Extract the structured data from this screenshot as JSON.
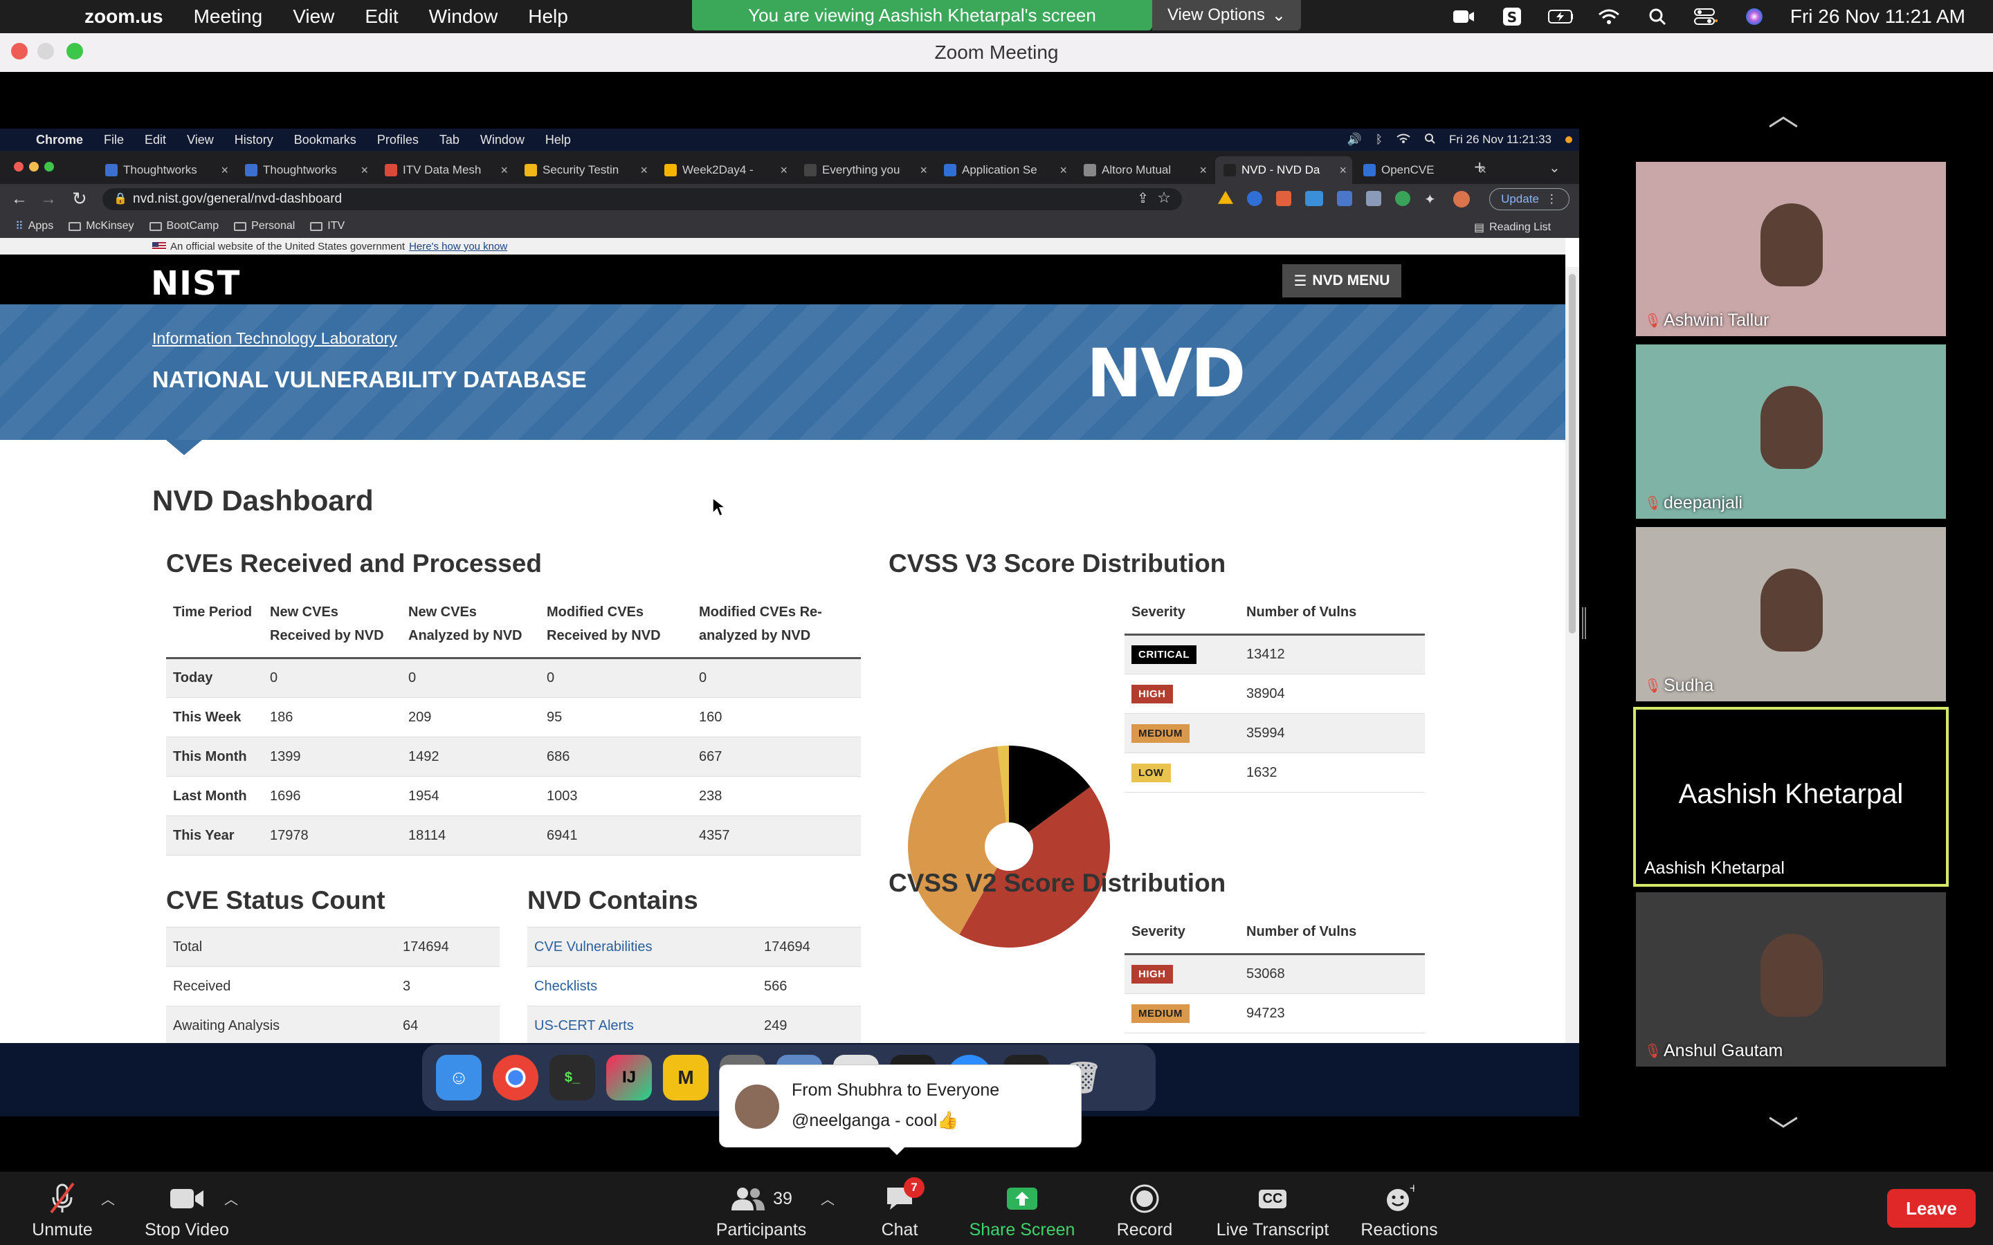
{
  "menubar": {
    "app": "zoom.us",
    "items": [
      "Meeting",
      "View",
      "Edit",
      "Window",
      "Help"
    ],
    "clock": "Fri 26 Nov  11:21 AM",
    "share_banner": "You are viewing Aashish Khetarpal's screen",
    "view_options": "View Options",
    "icons": [
      "zoom-video-icon",
      "s-app-icon",
      "battery-charging-icon",
      "wifi-icon",
      "search-icon",
      "control-center-icon",
      "siri-icon"
    ]
  },
  "zoom_window": {
    "title": "Zoom Meeting"
  },
  "shared_mac": {
    "app": "Chrome",
    "items": [
      "File",
      "Edit",
      "View",
      "History",
      "Bookmarks",
      "Profiles",
      "Tab",
      "Window",
      "Help"
    ],
    "clock": "Fri 26 Nov  11:21:33"
  },
  "chrome": {
    "tabs": [
      {
        "label": "Thoughtworks",
        "color": "#3c6fcf"
      },
      {
        "label": "Thoughtworks",
        "color": "#3c6fcf"
      },
      {
        "label": "ITV Data Mesh",
        "color": "#d94a3a"
      },
      {
        "label": "Security Testin",
        "color": "#f2b619"
      },
      {
        "label": "Week2Day4 -",
        "color": "#f4b400"
      },
      {
        "label": "Everything you",
        "color": "#444444"
      },
      {
        "label": "Application Se",
        "color": "#2f6fd6"
      },
      {
        "label": "Altoro Mutual",
        "color": "#888888"
      },
      {
        "label": "NVD - NVD Da",
        "color": "#222222"
      },
      {
        "label": "OpenCVE",
        "color": "#2f6fd6"
      }
    ],
    "url": "nvd.nist.gov/general/nvd-dashboard",
    "update_label": "Update",
    "bookmarks": [
      "Apps",
      "McKinsey",
      "BootCamp",
      "Personal",
      "ITV"
    ],
    "reading_list": "Reading List"
  },
  "nvd": {
    "gov_banner": "An official website of the United States government",
    "gov_link": "Here's how you know",
    "nist_logo": "NIST",
    "menu_label": "NVD MENU",
    "itl_link": "Information Technology Laboratory",
    "site_title": "NATIONAL VULNERABILITY DATABASE",
    "nvd_logo": "NVD",
    "dashboard_title": "NVD Dashboard",
    "cves": {
      "title": "CVEs Received and Processed",
      "headers": [
        "Time Period",
        "New CVEs Received by NVD",
        "New CVEs Analyzed by NVD",
        "Modified CVEs Received by NVD",
        "Modified CVEs Re-analyzed by NVD"
      ],
      "rows": [
        [
          "Today",
          "0",
          "0",
          "0",
          "0"
        ],
        [
          "This Week",
          "186",
          "209",
          "95",
          "160"
        ],
        [
          "This Month",
          "1399",
          "1492",
          "686",
          "667"
        ],
        [
          "Last Month",
          "1696",
          "1954",
          "1003",
          "238"
        ],
        [
          "This Year",
          "17978",
          "18114",
          "6941",
          "4357"
        ]
      ]
    },
    "status": {
      "title": "CVE Status Count",
      "rows": [
        [
          "Total",
          "174694"
        ],
        [
          "Received",
          "3"
        ],
        [
          "Awaiting Analysis",
          "64"
        ]
      ]
    },
    "contains": {
      "title": "NVD Contains",
      "rows": [
        [
          "CVE Vulnerabilities",
          "174694"
        ],
        [
          "Checklists",
          "566"
        ],
        [
          "US-CERT Alerts",
          "249"
        ]
      ]
    },
    "v3": {
      "title": "CVSS V3 Score Distribution",
      "headers": [
        "Severity",
        "Number of Vulns"
      ],
      "rows": [
        {
          "sev": "CRITICAL",
          "count": "13412",
          "bg": "#000000",
          "fg": "#ffffff"
        },
        {
          "sev": "HIGH",
          "count": "38904",
          "bg": "#b33d2f",
          "fg": "#ffffff"
        },
        {
          "sev": "MEDIUM",
          "count": "35994",
          "bg": "#d9984a",
          "fg": "#222222"
        },
        {
          "sev": "LOW",
          "count": "1632",
          "bg": "#e8c34d",
          "fg": "#222222"
        }
      ]
    },
    "v2": {
      "title": "CVSS V2 Score Distribution",
      "headers": [
        "Severity",
        "Number of Vulns"
      ],
      "rows": [
        {
          "sev": "HIGH",
          "count": "53068",
          "bg": "#b33d2f",
          "fg": "#ffffff"
        },
        {
          "sev": "MEDIUM",
          "count": "94723",
          "bg": "#d9984a",
          "fg": "#222222"
        }
      ]
    }
  },
  "chart_data": [
    {
      "type": "pie",
      "title": "CVSS V3 Score Distribution",
      "categories": [
        "CRITICAL",
        "HIGH",
        "MEDIUM",
        "LOW"
      ],
      "values": [
        13412,
        38904,
        35994,
        1632
      ],
      "colors": [
        "#000000",
        "#b33d2f",
        "#d9984a",
        "#e8c34d"
      ]
    },
    {
      "type": "pie",
      "title": "CVSS V2 Score Distribution",
      "categories": [
        "HIGH",
        "MEDIUM"
      ],
      "values": [
        53068,
        94723
      ],
      "colors": [
        "#b33d2f",
        "#d9984a"
      ]
    }
  ],
  "toast": {
    "from": "From Shubhra to Everyone",
    "message": "@neelganga - cool👍"
  },
  "participants": [
    {
      "name": "Ashwini Tallur",
      "bg": "#c9a7a8"
    },
    {
      "name": "deepanjali",
      "bg": "#7fb3a5"
    },
    {
      "name": "Sudha",
      "bg": "#b9b3ad"
    },
    {
      "name": "Aashish Khetarpal",
      "bg": "#000000"
    },
    {
      "name": "Anshul Gautam",
      "bg": "#3c3c3c"
    }
  ],
  "active_speaker": "Aashish Khetarpal",
  "controls": {
    "unmute": "Unmute",
    "stop_video": "Stop Video",
    "participants": "Participants",
    "participants_count": "39",
    "chat": "Chat",
    "chat_badge": "7",
    "share_screen": "Share Screen",
    "record": "Record",
    "live_transcript": "Live Transcript",
    "live_transcript_icon": "CC",
    "reactions": "Reactions",
    "leave": "Leave"
  }
}
